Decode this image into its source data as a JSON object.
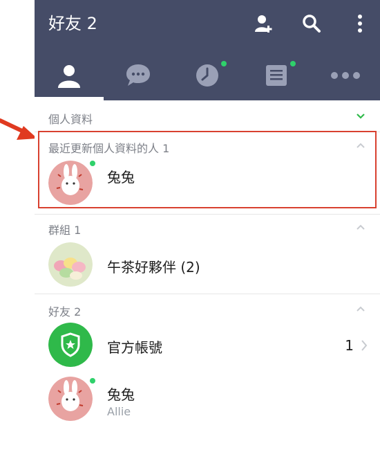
{
  "header": {
    "title": "好友 2",
    "actions": [
      "add-friend-icon",
      "search-icon",
      "more-vert-icon"
    ]
  },
  "tabs": [
    {
      "icon": "friends-icon",
      "active": true
    },
    {
      "icon": "chat-icon",
      "active": false
    },
    {
      "icon": "timeline-icon",
      "active": false,
      "new": true
    },
    {
      "icon": "news-icon",
      "active": false,
      "new": true
    },
    {
      "icon": "more-icon",
      "active": false
    }
  ],
  "sections": {
    "profile": {
      "title": "個人資料"
    },
    "recent": {
      "title": "最近更新個人資料的人 1",
      "items": [
        {
          "name": "兔兔",
          "online": true
        }
      ]
    },
    "groups": {
      "title": "群組 1",
      "items": [
        {
          "name": "午茶好夥伴 (2)"
        }
      ]
    },
    "friends": {
      "title": "好友 2",
      "items": [
        {
          "name": "官方帳號",
          "count": "1"
        },
        {
          "name": "兔兔",
          "sub": "Allie",
          "online": true
        }
      ]
    }
  },
  "colors": {
    "header": "#454c67",
    "online": "#2fd16b",
    "highlight": "#d8402f",
    "official": "#2fb94a"
  }
}
